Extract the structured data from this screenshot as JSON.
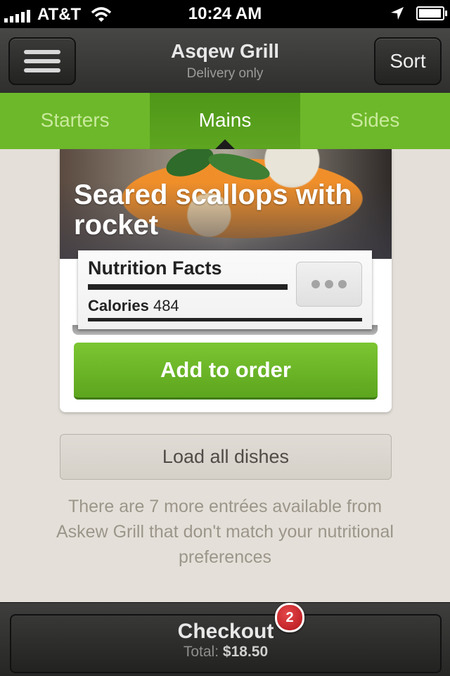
{
  "status_bar": {
    "carrier": "AT&T",
    "time": "10:24 AM",
    "battery_level": 0.85,
    "icons": [
      "signal-icon",
      "wifi-icon",
      "location-arrow-icon",
      "battery-icon"
    ]
  },
  "header": {
    "title": "Asqew Grill",
    "subtitle": "Delivery only",
    "menu_icon": "hamburger-menu-icon",
    "sort_label": "Sort"
  },
  "tabs": [
    {
      "label": "Starters",
      "active": false
    },
    {
      "label": "Mains",
      "active": true
    },
    {
      "label": "Sides",
      "active": false
    }
  ],
  "dish": {
    "title": "Seared scallops with rocket",
    "nutrition": {
      "heading": "Nutrition Facts",
      "calories_label": "Calories",
      "calories_value": "484",
      "more_icon": "more-dots-icon"
    },
    "add_button": "Add to order"
  },
  "load_all_label": "Load all dishes",
  "info_text": "There are 7 more entrées available from Askew Grill that don't match your nutritional preferences",
  "checkout": {
    "label": "Checkout",
    "total_label": "Total:",
    "total_value": "$18.50",
    "badge_count": "2"
  },
  "colors": {
    "accent_green": "#6db82a",
    "badge_red": "#c8191f",
    "background": "#e4e0d9"
  }
}
